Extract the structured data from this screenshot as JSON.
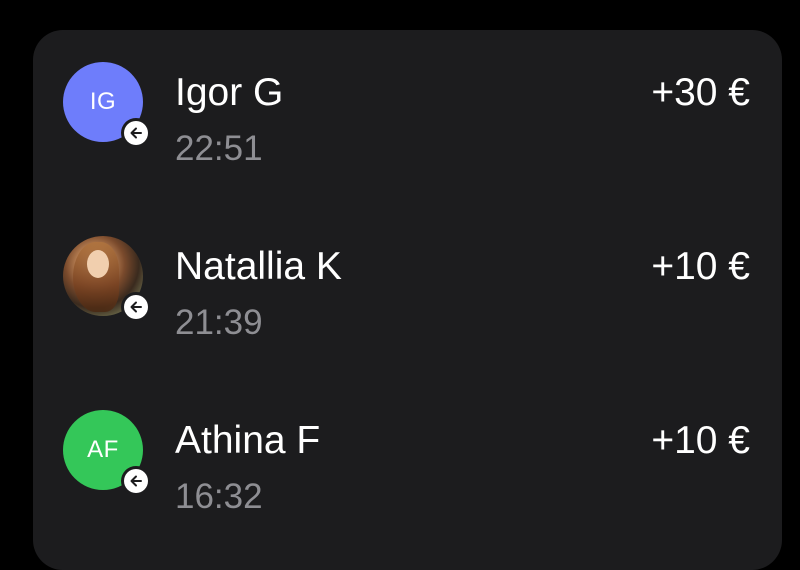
{
  "colors": {
    "background": "#000000",
    "card": "#1c1c1e",
    "text_primary": "#ffffff",
    "text_secondary": "#8e8e93"
  },
  "transactions": [
    {
      "avatar_type": "initials",
      "initials": "IG",
      "avatar_color": "#6e7dfb",
      "name": "Igor G",
      "time": "22:51",
      "amount": "+30 €",
      "badge_icon": "arrow-left-icon"
    },
    {
      "avatar_type": "photo",
      "initials": "",
      "avatar_color": "",
      "name": "Natallia K",
      "time": "21:39",
      "amount": "+10 €",
      "badge_icon": "arrow-left-icon"
    },
    {
      "avatar_type": "initials",
      "initials": "AF",
      "avatar_color": "#34c759",
      "name": "Athina F",
      "time": "16:32",
      "amount": "+10 €",
      "badge_icon": "arrow-left-icon"
    }
  ]
}
